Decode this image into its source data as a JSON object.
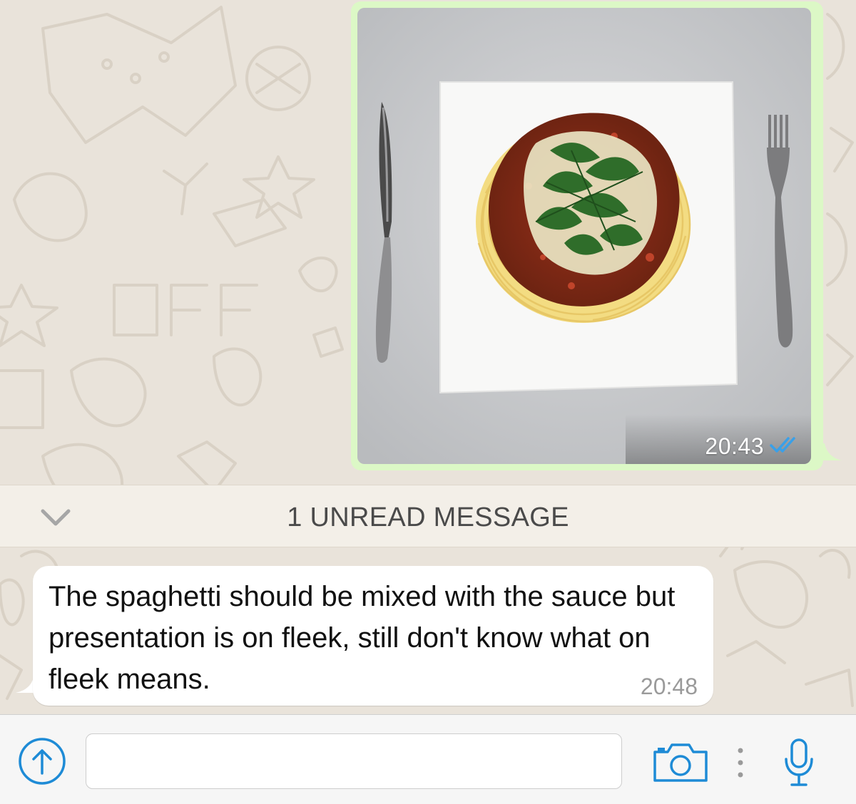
{
  "outgoing_message": {
    "type": "image",
    "time": "20:43",
    "status_icon": "double-check-blue-icon"
  },
  "unread_divider": {
    "label": "1 UNREAD MESSAGE",
    "icon": "chevron-down-icon"
  },
  "incoming_message": {
    "text": "The spaghetti should be mixed with the sauce but presentation is on fleek, still don't know what on fleek means.",
    "time": "20:48"
  },
  "composer": {
    "input_value": "",
    "attach_icon": "upload-arrow-icon",
    "camera_icon": "camera-icon",
    "more_icon": "vertical-dots-icon",
    "mic_icon": "microphone-icon"
  },
  "colors": {
    "outgoing_bubble": "#dcf8c6",
    "incoming_bubble": "#ffffff",
    "accent_blue": "#1e8bd6",
    "read_ticks": "#3aa0e8"
  }
}
